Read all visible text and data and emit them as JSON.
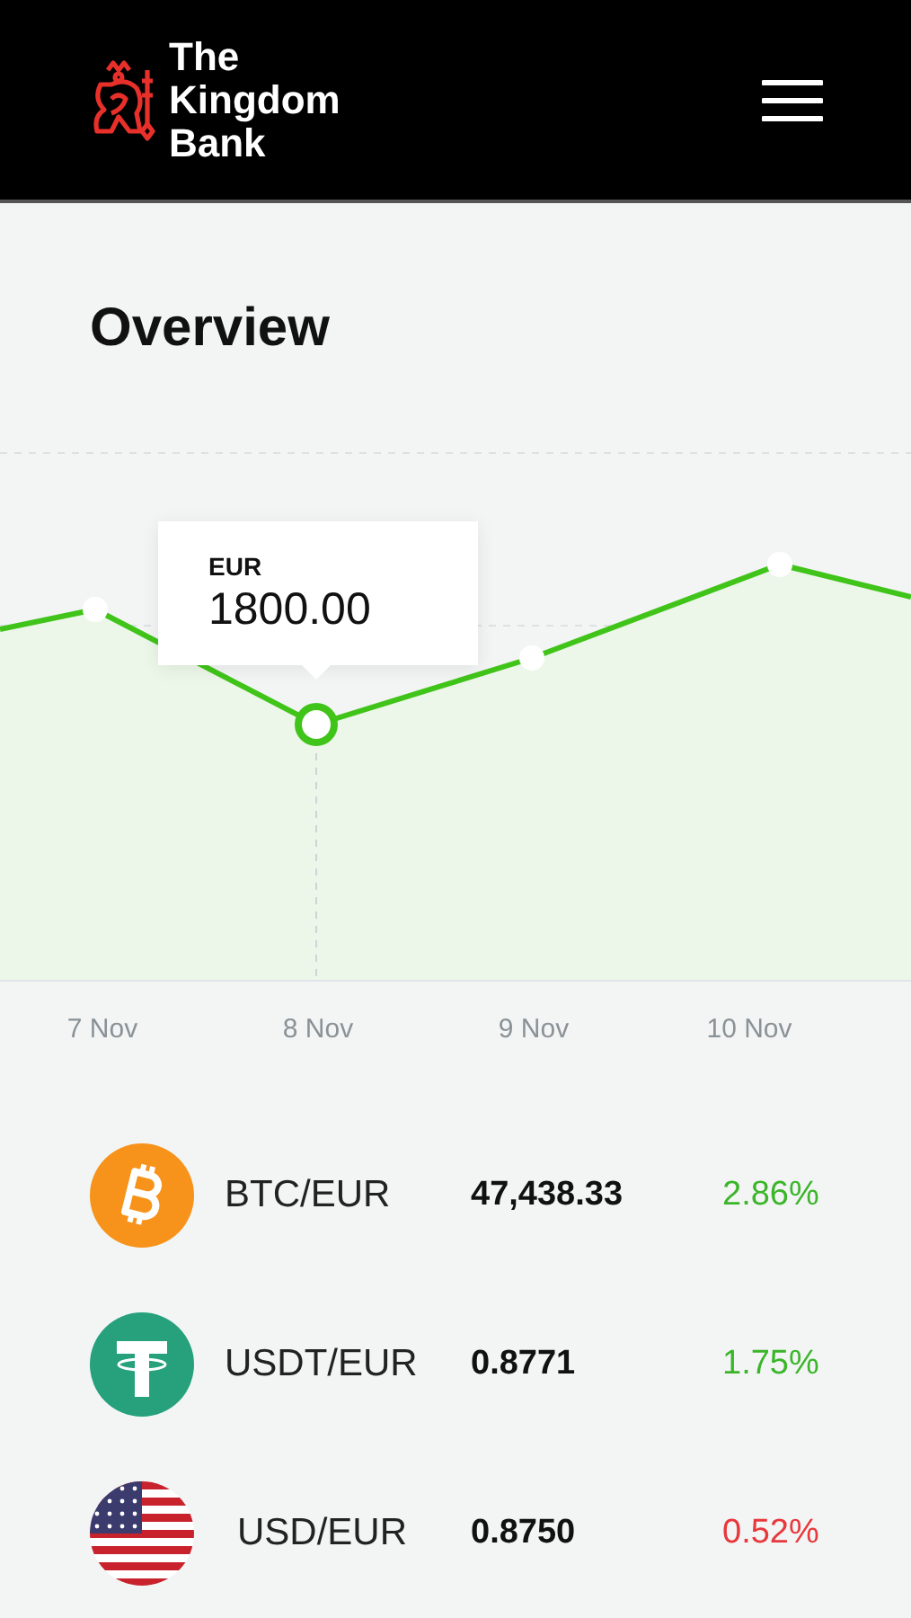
{
  "header": {
    "brand": [
      "The",
      "Kingdom",
      "Bank"
    ]
  },
  "page_title": "Overview",
  "chart": {
    "tooltip": {
      "label": "EUR",
      "value": "1800.00"
    },
    "x_labels": [
      "7 Nov",
      "8 Nov",
      "9 Nov",
      "10 Nov"
    ]
  },
  "rates": [
    {
      "kind": "bitcoin",
      "pair": "BTC/EUR",
      "price": "47,438.33",
      "change": "2.86%",
      "color": "#3bb52a"
    },
    {
      "kind": "tether",
      "pair": "USDT/EUR",
      "price": "0.8771",
      "change": "1.75%",
      "color": "#3bb52a"
    },
    {
      "kind": "flag",
      "pair": "USD/EUR",
      "price": "0.8750",
      "change": "0.52%",
      "color": "#e8383c"
    }
  ]
}
